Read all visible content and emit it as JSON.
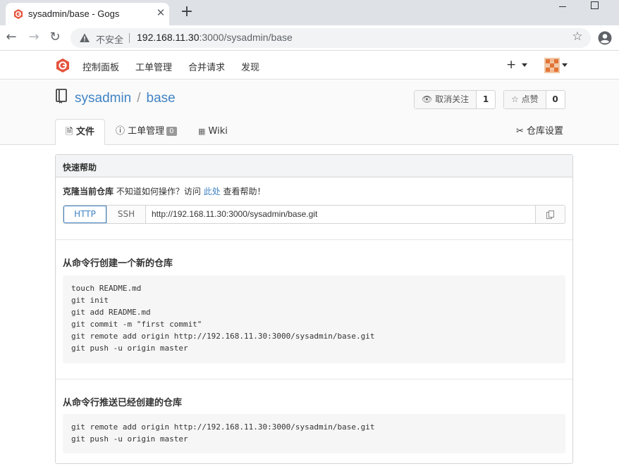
{
  "browser": {
    "tab_title": "sysadmin/base - Gogs",
    "new_tab": "+",
    "insecure_label": "不安全",
    "url_host": "192.168.11.30",
    "url_rest": ":3000/sysadmin/base"
  },
  "nav": {
    "items": [
      "控制面板",
      "工单管理",
      "合并请求",
      "发现"
    ],
    "plus": "+"
  },
  "repo": {
    "owner": "sysadmin",
    "separator": "/",
    "name": "base",
    "unwatch_label": "取消关注",
    "watch_count": "1",
    "star_label": "点赞",
    "star_count": "0",
    "tabs": {
      "files": "文件",
      "issues": "工单管理",
      "issues_count": "0",
      "wiki": "Wiki",
      "settings": "仓库设置"
    }
  },
  "quick_help": {
    "header": "快速帮助",
    "clone_title": "克隆当前仓库",
    "clone_hint": "不知道如何操作？访问",
    "clone_link": "此处",
    "clone_tail": "查看帮助！",
    "http_label": "HTTP",
    "ssh_label": "SSH",
    "clone_url": "http://192.168.11.30:3000/sysadmin/base.git",
    "new_repo_title": "从命令行创建一个新的仓库",
    "new_repo_code": "touch README.md\ngit init\ngit add README.md\ngit commit -m \"first commit\"\ngit remote add origin http://192.168.11.30:3000/sysadmin/base.git\ngit push -u origin master",
    "push_repo_title": "从命令行推送已经创建的仓库",
    "push_repo_code": "git remote add origin http://192.168.11.30:3000/sysadmin/base.git\ngit push -u origin master"
  },
  "colors": {
    "link": "#4183c4",
    "gogs_brand": "#e5533d"
  }
}
